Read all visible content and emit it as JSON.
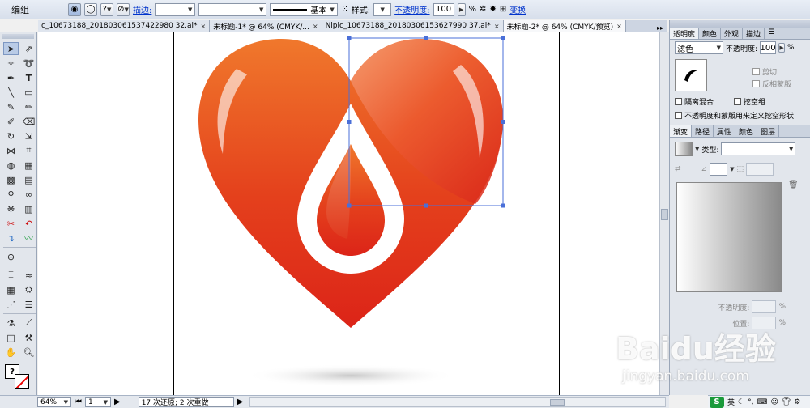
{
  "control_bar": {
    "selection_label": "编组",
    "stroke_link": "描边:",
    "stroke_style": "基本",
    "style_label": "样式:",
    "opacity_link": "不透明度:",
    "opacity_value": "100",
    "opacity_unit": "%",
    "transform_link": "变换",
    "help_glyph": "?"
  },
  "tabs": [
    {
      "label": "c_10673188_201803061537422980 32.ai*",
      "active": false
    },
    {
      "label": "未标题-1* @ 64% (CMYK/...",
      "active": false
    },
    {
      "label": "Nipic_10673188_20180306153627990 37.ai*",
      "active": false
    },
    {
      "label": "未标题-2* @ 64% (CMYK/预览)",
      "active": true
    }
  ],
  "tab_close_glyph": "×",
  "status_bar": {
    "zoom": "64%",
    "page": "1",
    "history": "17 次还原; 2 次重做"
  },
  "transparency_panel": {
    "tabs": [
      "透明度",
      "颜色",
      "外观",
      "描边"
    ],
    "blend_mode": "滤色",
    "opacity_label": "不透明度:",
    "opacity_value": "100",
    "opacity_unit": "%",
    "clip_label": "剪切",
    "invert_mask_label": "反相蒙版",
    "isolate_blend_label": "隔离混合",
    "knockout_group_label": "挖空组",
    "opacity_mask_label": "不透明度和蒙版用来定义挖空形状"
  },
  "gradient_panel": {
    "tabs": [
      "渐变",
      "路径",
      "属性",
      "颜色",
      "图层"
    ],
    "type_label": "类型:",
    "opacity_label": "不透明度:",
    "location_label": "位置:",
    "unit": "%"
  },
  "watermark": {
    "main": "Baidu经验",
    "sub": "jingyan.baidu.com"
  },
  "ime": {
    "logo": "S",
    "lang": "英"
  },
  "colors": {
    "heart_light": "#f0782c",
    "heart_dark": "#dc2418",
    "accent_link": "#0033cc",
    "selection": "#4a6fd8"
  }
}
